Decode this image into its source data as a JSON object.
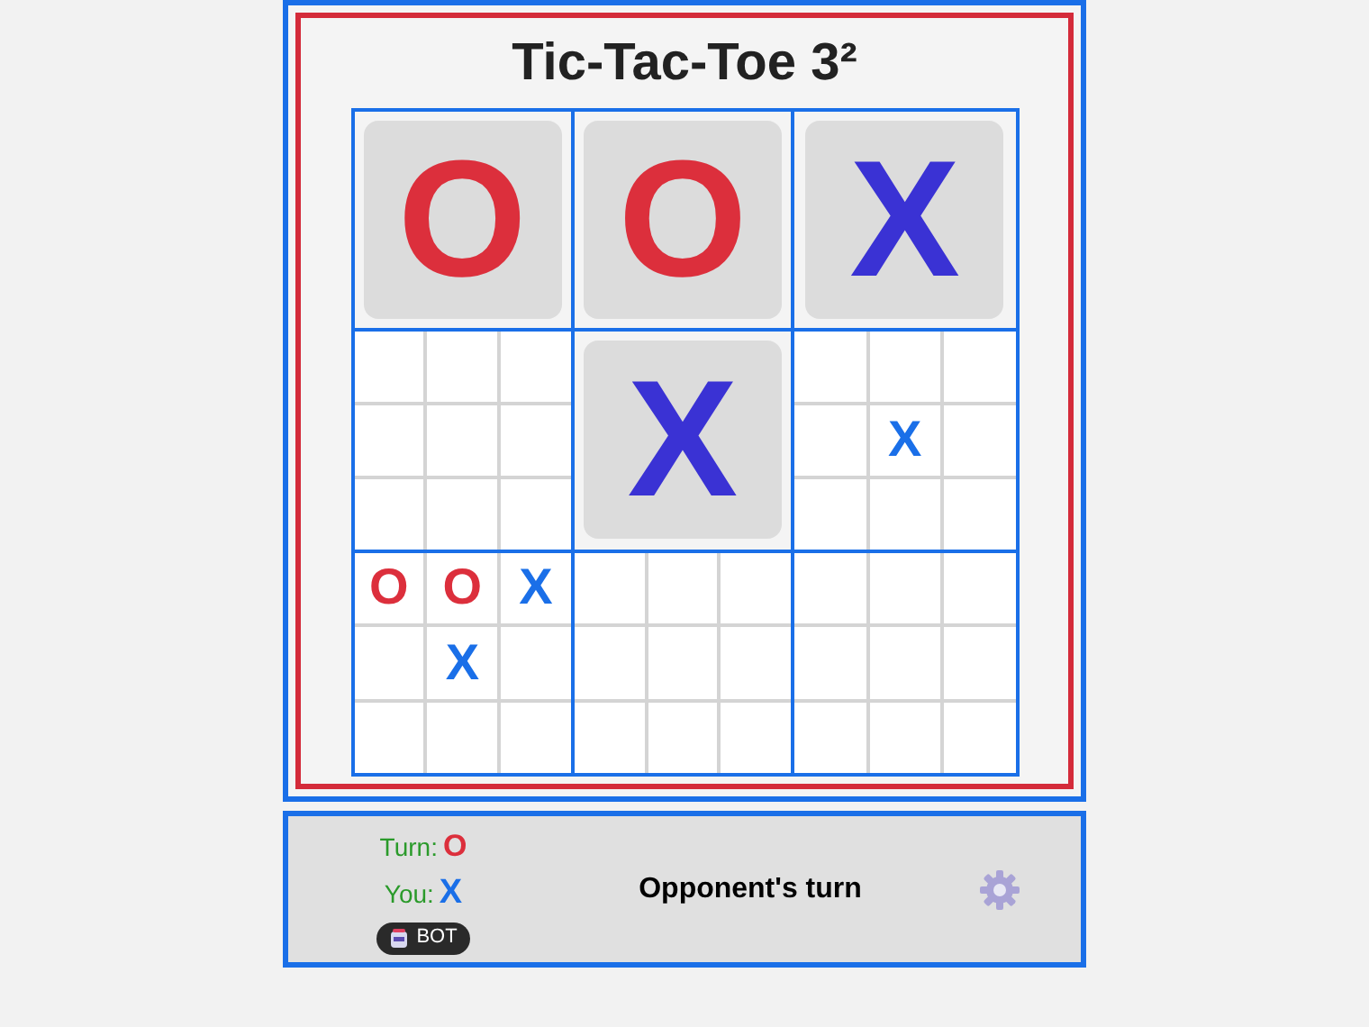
{
  "title": "Tic-Tac-Toe 3²",
  "boards": [
    {
      "kind": "won",
      "winner": "O"
    },
    {
      "kind": "won",
      "winner": "O"
    },
    {
      "kind": "won",
      "winner": "X"
    },
    {
      "kind": "open",
      "cells": [
        {},
        {},
        {},
        {},
        {},
        {},
        {},
        {},
        {}
      ]
    },
    {
      "kind": "won",
      "winner": "X"
    },
    {
      "kind": "open",
      "cells": [
        {},
        {},
        {},
        {},
        {
          "mark": "X"
        },
        {},
        {},
        {},
        {}
      ]
    },
    {
      "kind": "open",
      "cells": [
        {
          "mark": "O"
        },
        {
          "mark": "O"
        },
        {
          "mark": "X"
        },
        {},
        {
          "mark": "X"
        },
        {},
        {},
        {},
        {}
      ]
    },
    {
      "kind": "open",
      "cells": [
        {},
        {},
        {},
        {},
        {},
        {},
        {},
        {},
        {}
      ]
    },
    {
      "kind": "open",
      "cells": [
        {},
        {},
        {},
        {},
        {},
        {},
        {},
        {},
        {}
      ]
    }
  ],
  "status": {
    "turn_label": "Turn:",
    "turn_mark": "O",
    "you_label": "You:",
    "you_mark": "X",
    "badge": "BOT",
    "message": "Opponent's turn"
  }
}
